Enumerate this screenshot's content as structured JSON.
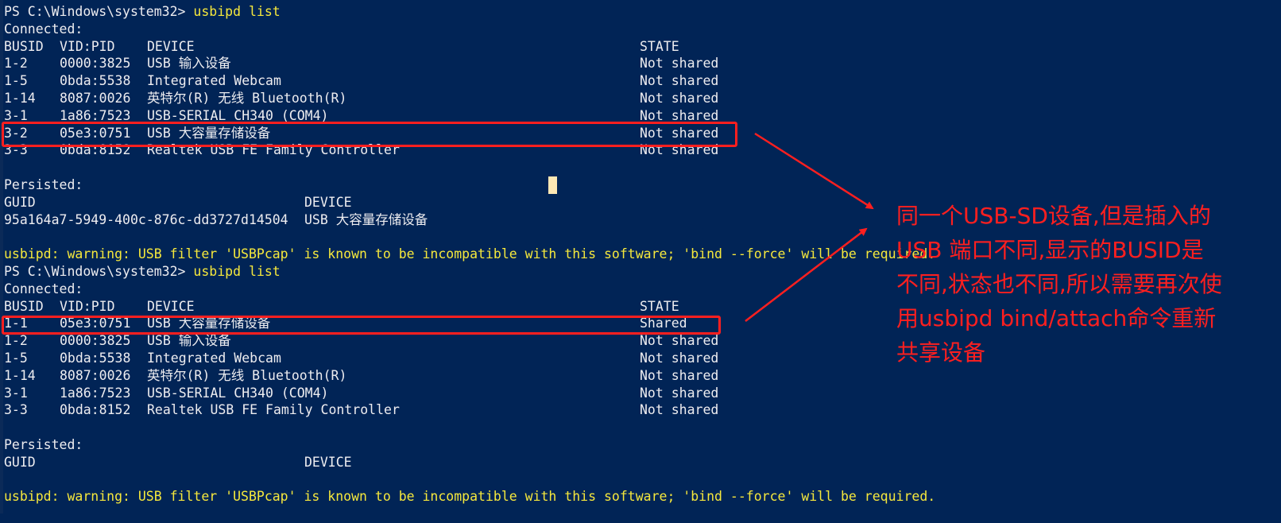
{
  "window": {
    "background": "#012456",
    "text_color": "#eeedf0",
    "warning_color": "#f6e83c",
    "annotation_color": "#ff1f1f"
  },
  "block1": {
    "prompt": "PS C:\\Windows\\system32> ",
    "command": "usbipd list",
    "connected_label": "Connected:",
    "headers": [
      "BUSID",
      "VID:PID",
      "DEVICE",
      "STATE"
    ],
    "rows": [
      [
        "1-2",
        "0000:3825",
        "USB 输入设备",
        "Not shared"
      ],
      [
        "1-5",
        "0bda:5538",
        "Integrated Webcam",
        "Not shared"
      ],
      [
        "1-14",
        "8087:0026",
        "英特尔(R) 无线 Bluetooth(R)",
        "Not shared"
      ],
      [
        "3-1",
        "1a86:7523",
        "USB-SERIAL CH340 (COM4)",
        "Not shared"
      ],
      [
        "3-2",
        "05e3:0751",
        "USB 大容量存储设备",
        "Not shared"
      ],
      [
        "3-3",
        "0bda:8152",
        "Realtek USB FE Family Controller",
        "Not shared"
      ]
    ],
    "persisted_label": "Persisted:",
    "persisted_headers": [
      "GUID",
      "DEVICE"
    ],
    "persisted_rows": [
      [
        "95a164a7-5949-400c-876c-dd3727d14504",
        "USB 大容量存储设备"
      ]
    ],
    "warning": "usbipd: warning: USB filter 'USBPcap' is known to be incompatible with this software; 'bind --force' will be required."
  },
  "block2": {
    "prompt": "PS C:\\Windows\\system32> ",
    "command": "usbipd list",
    "connected_label": "Connected:",
    "headers": [
      "BUSID",
      "VID:PID",
      "DEVICE",
      "STATE"
    ],
    "rows": [
      [
        "1-1",
        "05e3:0751",
        "USB 大容量存储设备",
        "Shared"
      ],
      [
        "1-2",
        "0000:3825",
        "USB 输入设备",
        "Not shared"
      ],
      [
        "1-5",
        "0bda:5538",
        "Integrated Webcam",
        "Not shared"
      ],
      [
        "1-14",
        "8087:0026",
        "英特尔(R) 无线 Bluetooth(R)",
        "Not shared"
      ],
      [
        "3-1",
        "1a86:7523",
        "USB-SERIAL CH340 (COM4)",
        "Not shared"
      ],
      [
        "3-3",
        "0bda:8152",
        "Realtek USB FE Family Controller",
        "Not shared"
      ]
    ],
    "persisted_label": "Persisted:",
    "persisted_headers": [
      "GUID",
      "DEVICE"
    ],
    "warning": "usbipd: warning: USB filter 'USBPcap' is known to be incompatible with this software; 'bind --force' will be required."
  },
  "annotation": {
    "text": "同一个USB-SD设备,但是插入的\nUSB 端口不同,显示的BUSID是\n不同,状态也不同,所以需要再次使\n用usbipd bind/attach命令重新\n共享设备"
  }
}
